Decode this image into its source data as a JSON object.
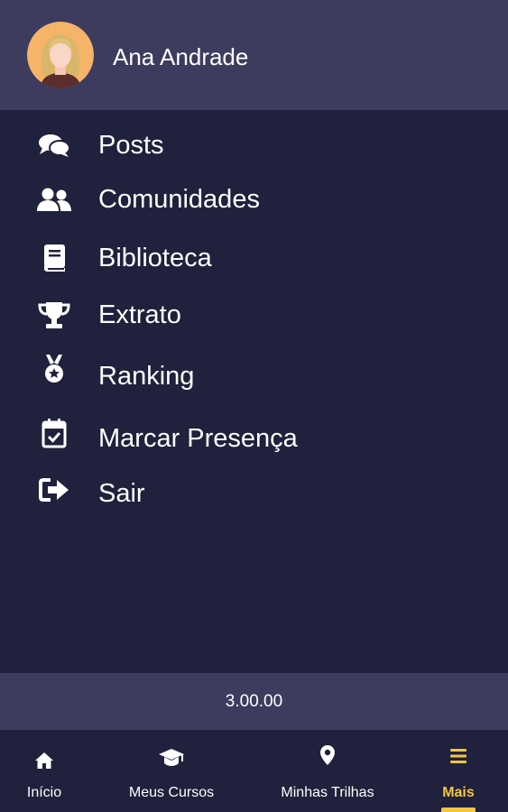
{
  "profile": {
    "name": "Ana Andrade",
    "avatar_icon": "female-avatar-icon"
  },
  "menu": {
    "items": [
      {
        "label": "Posts",
        "icon": "comments-icon"
      },
      {
        "label": "Comunidades",
        "icon": "users-icon"
      },
      {
        "label": "Biblioteca",
        "icon": "book-icon"
      },
      {
        "label": "Extrato",
        "icon": "trophy-icon"
      },
      {
        "label": "Ranking",
        "icon": "medal-icon"
      },
      {
        "label": "Marcar Presença",
        "icon": "calendar-check-icon"
      },
      {
        "label": "Sair",
        "icon": "sign-out-icon"
      }
    ]
  },
  "version": {
    "text": "3.00.00"
  },
  "bottom_nav": {
    "items": [
      {
        "label": "Início",
        "icon": "home-icon",
        "active": false
      },
      {
        "label": "Meus Cursos",
        "icon": "graduation-cap-icon",
        "active": false
      },
      {
        "label": "Minhas Trilhas",
        "icon": "map-marker-icon",
        "active": false
      },
      {
        "label": "Mais",
        "icon": "bars-icon",
        "active": true
      }
    ]
  },
  "colors": {
    "background": "#20213c",
    "header_background": "#3d3c5e",
    "accent": "#f5c542",
    "text": "#ffffff"
  }
}
